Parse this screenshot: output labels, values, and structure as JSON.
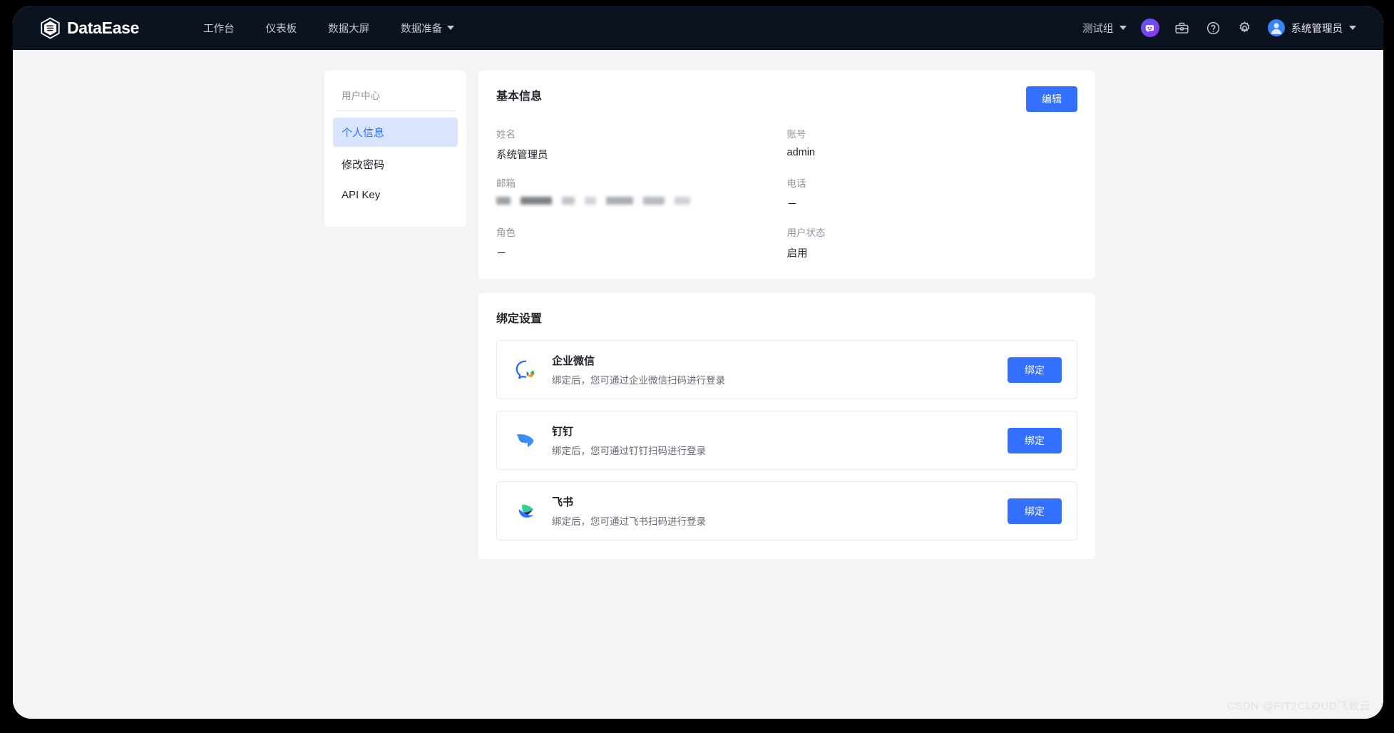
{
  "header": {
    "brand": "DataEase",
    "brand_logo_icon": "dataease-hexagon-logo",
    "nav": [
      {
        "label": "工作台",
        "has_caret": false
      },
      {
        "label": "仪表板",
        "has_caret": false
      },
      {
        "label": "数据大屏",
        "has_caret": false
      },
      {
        "label": "数据准备",
        "has_caret": true
      }
    ],
    "org": {
      "label": "测试组",
      "caret_icon": "chevron-down-icon"
    },
    "icons": [
      {
        "name": "ai-assistant-icon"
      },
      {
        "name": "toolbox-icon"
      },
      {
        "name": "help-circle-icon"
      },
      {
        "name": "gear-icon"
      }
    ],
    "user": {
      "name": "系统管理员",
      "avatar_icon": "user-avatar-icon",
      "caret_icon": "chevron-down-icon"
    },
    "bg_color": "#0b1220"
  },
  "sidebar": {
    "title": "用户中心",
    "items": [
      {
        "label": "个人信息",
        "active": true
      },
      {
        "label": "修改密码",
        "active": false
      },
      {
        "label": "API Key",
        "active": false
      }
    ],
    "active_bg": "#d9e4fd",
    "active_color": "#3370ff"
  },
  "basic_info": {
    "title": "基本信息",
    "edit_label": "编辑",
    "fields": [
      {
        "label": "姓名",
        "value": "系统管理员",
        "redacted": false
      },
      {
        "label": "账号",
        "value": "admin",
        "redacted": false
      },
      {
        "label": "邮箱",
        "value": "",
        "redacted": true
      },
      {
        "label": "电话",
        "value": "－",
        "redacted": false
      },
      {
        "label": "角色",
        "value": "－",
        "redacted": false
      },
      {
        "label": "用户状态",
        "value": "启用",
        "redacted": false
      }
    ]
  },
  "binding": {
    "title": "绑定设置",
    "rows": [
      {
        "name": "企业微信",
        "desc": "绑定后，您可通过企业微信扫码进行登录",
        "button": "绑定",
        "icon": "wecom-icon"
      },
      {
        "name": "钉钉",
        "desc": "绑定后，您可通过钉钉扫码进行登录",
        "button": "绑定",
        "icon": "dingtalk-icon"
      },
      {
        "name": "飞书",
        "desc": "绑定后，您可通过飞书扫码进行登录",
        "button": "绑定",
        "icon": "feishu-icon"
      }
    ]
  },
  "watermark": "CSDN @FIT2CLOUD飞致云",
  "colors": {
    "primary": "#3370ff",
    "page_bg": "#f3f4f6",
    "card_bg": "#ffffff",
    "text_primary": "#1f2329",
    "text_secondary": "#8f959e"
  }
}
